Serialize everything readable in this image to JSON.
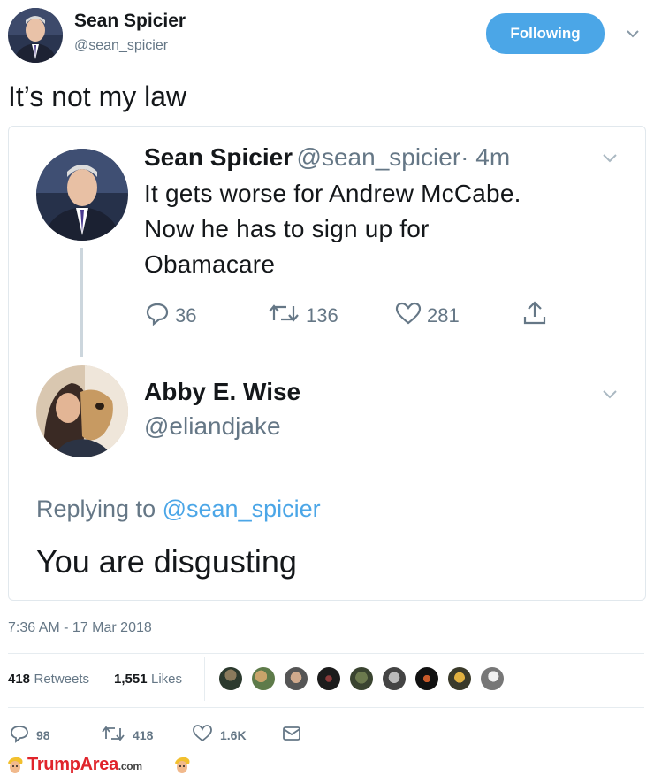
{
  "tweet": {
    "author_name": "Sean Spicier",
    "author_handle": "@sean_spicier",
    "follow_label": "Following",
    "text": "It’s not my law",
    "timestamp": "7:36 AM - 17 Mar 2018",
    "retweets_count": "418",
    "retweets_label": "Retweets",
    "likes_count": "1,551",
    "likes_label": "Likes"
  },
  "quoted": {
    "author_name": "Sean Spicier",
    "author_handle": "@sean_spicier",
    "time": "· 4m",
    "text_lines": [
      "It gets worse for Andrew McCabe.",
      "Now he has to sign up for",
      "Obamacare"
    ],
    "replies": "36",
    "retweets": "136",
    "likes": "281"
  },
  "reply": {
    "author_name": "Abby E. Wise",
    "author_handle": "@eliandjake",
    "replying_prefix": "Replying to",
    "replying_handle": "@sean_spicier",
    "text": "You are disgusting"
  },
  "actions": {
    "replies": "98",
    "retweets": "418",
    "likes": "1.6K"
  },
  "watermark": {
    "brand": "TrumpArea",
    "suffix": ".com"
  },
  "colors": {
    "accent": "#4ba6e7",
    "secondary_text": "#657786",
    "brand": "#e0242b"
  },
  "icons": [
    "chevron-down-icon",
    "reply-icon",
    "retweet-icon",
    "heart-icon",
    "share-icon",
    "dm-icon",
    "trump-head-icon"
  ]
}
